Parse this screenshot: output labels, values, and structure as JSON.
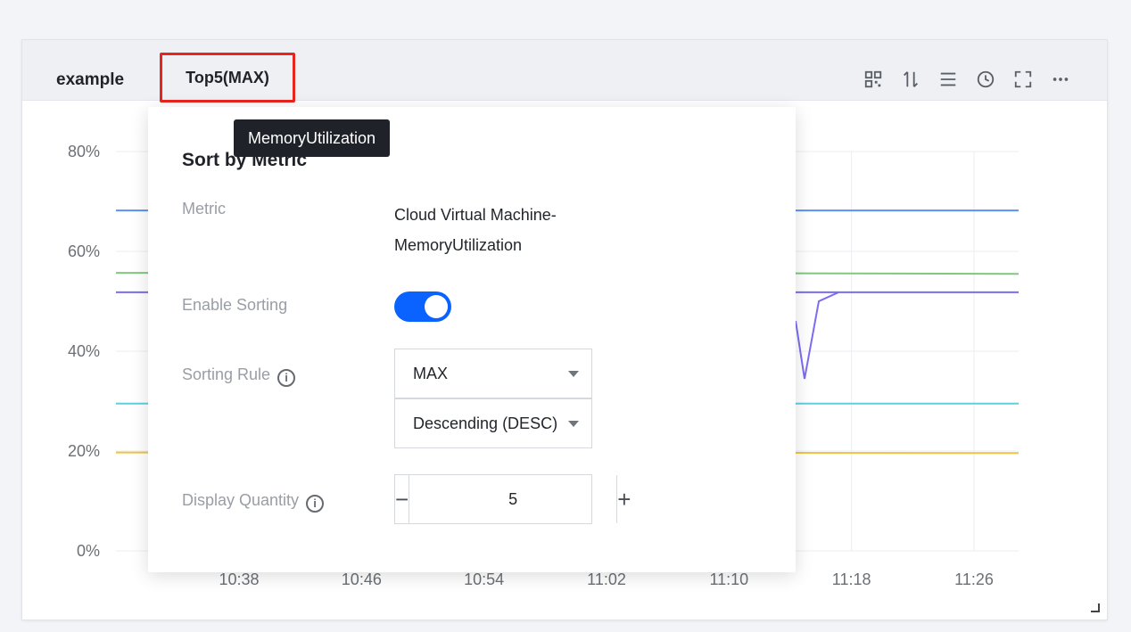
{
  "panel": {
    "title": "example",
    "top_badge": "Top5(MAX)",
    "toolbar_icons": [
      "qr-icon",
      "sort-icon",
      "list-icon",
      "clock-icon",
      "fullscreen-icon",
      "more-icon"
    ]
  },
  "tooltip": {
    "text": "MemoryUtilization"
  },
  "popover": {
    "title": "Sort by Metric",
    "metric_label": "Metric",
    "metric_value_line1": "Cloud Virtual Machine-",
    "metric_value_line2": "MemoryUtilization",
    "enable_sorting_label": "Enable Sorting",
    "enable_sorting": true,
    "sorting_rule_label": "Sorting Rule",
    "sorting_rule_value": "MAX",
    "sort_order_value": "Descending (DESC)",
    "display_quantity_label": "Display Quantity",
    "display_quantity_value": "5",
    "minus": "−",
    "plus": "+"
  },
  "colors": {
    "accent": "#0a63ff",
    "badge_border": "#e8241f"
  },
  "chart_data": {
    "type": "line",
    "y_ticks": [
      "80%",
      "60%",
      "40%",
      "20%",
      "0%"
    ],
    "x_ticks": [
      "10:38",
      "10:46",
      "10:54",
      "11:02",
      "11:10",
      "11:18",
      "11:26"
    ],
    "ylim": [
      0,
      80
    ],
    "grid": true,
    "series": [
      {
        "color": "#5b8ff9",
        "values": [
          68.2,
          68.2,
          68.2
        ]
      },
      {
        "color": "#7ec97e",
        "values": [
          55.7,
          55.7,
          55.5
        ]
      },
      {
        "color": "#7b6cf2",
        "values": [
          51.8,
          51.8,
          51.8
        ]
      },
      {
        "color": "#5ed0dc",
        "values": [
          29.5,
          29.5,
          29.5
        ]
      },
      {
        "color": "#f0c341",
        "values": [
          19.7,
          19.7,
          19.6
        ]
      }
    ]
  }
}
